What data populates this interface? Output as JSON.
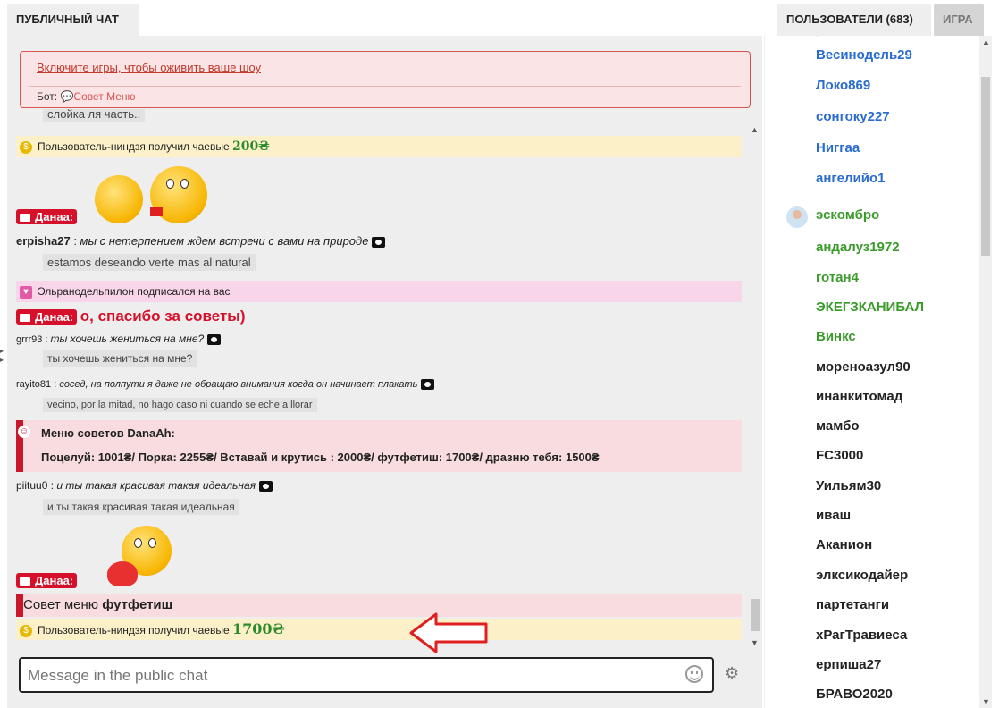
{
  "tabs": {
    "chat": "ПУБЛИЧНЫЙ ЧАТ",
    "users": "ПОЛЬЗОВАТЕЛИ (683)",
    "game": "ИГРА"
  },
  "notice": {
    "link": "Включите игры, чтобы оживить ваше шоу",
    "bot_prefix": "Бот:",
    "bot_menu": "💬Совет Меню"
  },
  "messages": {
    "partial_top": "слойка ля часть..",
    "tip1": {
      "user": "Пользователь-ниндзя",
      "text": " получил чаевые ",
      "amount": "200₴"
    },
    "dana_label": "Данаа:",
    "m1": {
      "user": "erpisha27",
      "sep": " : ",
      "text": "мы с нетерпением ждем встречи с вами на природе",
      "translation": "estamos deseando verte mas al natural"
    },
    "subscribe": {
      "user": "Эльранодельпилон",
      "text": " подписался на  вас"
    },
    "dana_msg": "о, спасибо за советы)",
    "m2": {
      "user": "grrr93",
      "sep": " : ",
      "text": "ты хочешь жениться на мне?",
      "translation": "ты хочешь жениться на мне?"
    },
    "m3": {
      "user": "rayito81",
      "sep": " : ",
      "text": "сосед, на полпути я даже не обращаю внимания когда он начинает плакать",
      "translation": "vecino, por la mitad, no hago caso ni cuando se eche a llorar"
    },
    "menu": {
      "title": "Меню советов DanaAh:",
      "items": "Поцелуй: 1001₴/ Порка: 2255₴/ Вставай и крутись : 2000₴/ футфетиш: 1700₴/ дразню тебя: 1500₴"
    },
    "m4": {
      "user": "piituu0",
      "sep": " : ",
      "text": "и ты такая красивая такая идеальная",
      "translation": "и ты такая красивая такая идеальная"
    },
    "menu_tip": {
      "prefix": "Совет меню ",
      "item": "футфетиш"
    },
    "tip2": {
      "user": "Пользователь-ниндзя",
      "text": " получил чаевые ",
      "amount": "1700₴"
    }
  },
  "input": {
    "placeholder": "Message in the public chat"
  },
  "users": [
    {
      "name": "Весинодель29",
      "color": "blue"
    },
    {
      "name": "Локо869",
      "color": "blue"
    },
    {
      "name": "сонгоку227",
      "color": "blue"
    },
    {
      "name": "Ниггаа",
      "color": "blue"
    },
    {
      "name": "ангелийо1",
      "color": "blue"
    },
    {
      "name": "эскомбро",
      "color": "green"
    },
    {
      "name": "андалуз1972",
      "color": "green"
    },
    {
      "name": "готан4",
      "color": "green"
    },
    {
      "name": "ЭКЕГЗКАНИБАЛ",
      "color": "green"
    },
    {
      "name": "Винкс",
      "color": "green"
    },
    {
      "name": "мореноазул90",
      "color": "black"
    },
    {
      "name": "инанкитомад",
      "color": "black"
    },
    {
      "name": "мамбо",
      "color": "black"
    },
    {
      "name": "FC3000",
      "color": "black"
    },
    {
      "name": "Уильям30",
      "color": "black"
    },
    {
      "name": "иваш",
      "color": "black"
    },
    {
      "name": "Аканион",
      "color": "black"
    },
    {
      "name": "элксикодайер",
      "color": "black"
    },
    {
      "name": "партетанги",
      "color": "black"
    },
    {
      "name": "хРагТравиеса",
      "color": "black"
    },
    {
      "name": "ерпиша27",
      "color": "black"
    },
    {
      "name": "БРАВО2020",
      "color": "black"
    }
  ],
  "colors": {
    "danger": "#d6102b",
    "tip_bg": "#fbf0c7",
    "pink_bg": "#f9d5ea",
    "user_blue": "#2a6bd0",
    "user_green": "#3a9b2b",
    "arrow": "#e02020"
  }
}
